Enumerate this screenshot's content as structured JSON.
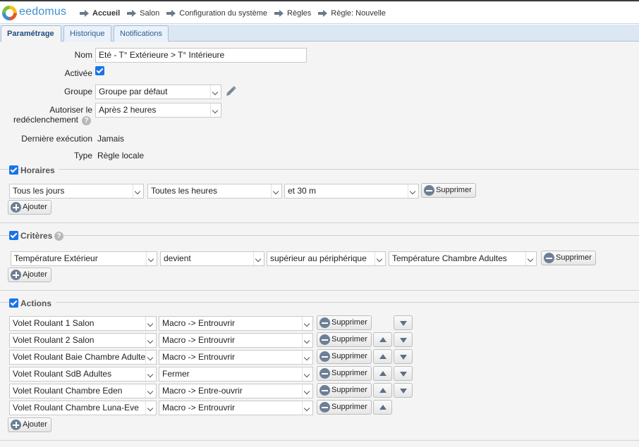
{
  "brand": "eedomus",
  "breadcrumb": [
    "Accueil",
    "Salon",
    "Configuration du système",
    "Règles",
    "Règle: Nouvelle"
  ],
  "tabs": [
    "Paramétrage",
    "Historique",
    "Notifications"
  ],
  "form": {
    "name_label": "Nom",
    "name_value": "Eté - T° Extérieure > T° Intérieure",
    "activated_label": "Activée",
    "activated": true,
    "group_label": "Groupe",
    "group_value": "Groupe par défaut",
    "retrigger_label_1": "Autoriser le",
    "retrigger_label_2": "redéclenchement",
    "retrigger_value": "Après 2 heures",
    "last_exec_label": "Dernière exécution",
    "last_exec_value": "Jamais",
    "type_label": "Type",
    "type_value": "Règle locale"
  },
  "horaires": {
    "title": "Horaires",
    "checked": true,
    "day": "Tous les jours",
    "hour": "Toutes les heures",
    "minute": "et 30 m",
    "delete_label": "Supprimer",
    "add_label": "Ajouter"
  },
  "criteres": {
    "title": "Critères",
    "checked": true,
    "device": "Température Extérieur",
    "condition": "devient",
    "comparator": "supérieur au périphérique",
    "target": "Température Chambre Adultes",
    "delete_label": "Supprimer",
    "add_label": "Ajouter"
  },
  "actions": {
    "title": "Actions",
    "checked": true,
    "delete_label": "Supprimer",
    "add_label": "Ajouter",
    "rows": [
      {
        "device": "Volet Roulant 1 Salon",
        "action": "Macro -> Entrouvrir"
      },
      {
        "device": "Volet Roulant 2 Salon",
        "action": "Macro -> Entrouvrir"
      },
      {
        "device": "Volet Roulant Baie Chambre Adultes",
        "action": "Macro -> Entrouvrir"
      },
      {
        "device": "Volet Roulant SdB Adultes",
        "action": "Fermer"
      },
      {
        "device": "Volet Roulant Chambre Eden",
        "action": "Macro -> Entre-ouvrir"
      },
      {
        "device": "Volet Roulant Chambre Luna-Eve",
        "action": "Macro -> Entrouvrir"
      }
    ]
  },
  "colors": {
    "brand": "#3b8fd1",
    "checkbox": "#1a73e8",
    "tab_bar": "#dce7f4",
    "panel_bg": "#f4f4f4"
  }
}
